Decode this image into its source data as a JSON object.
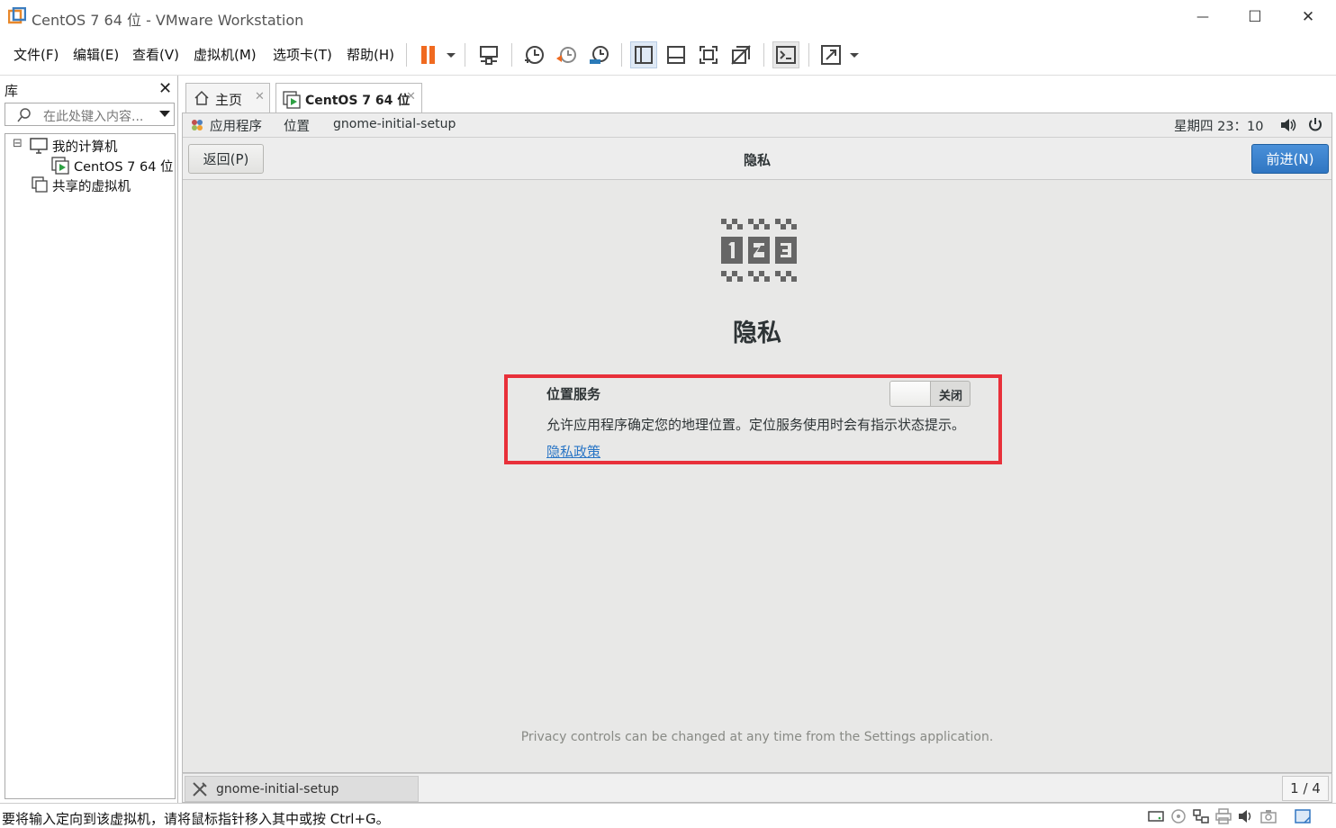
{
  "window": {
    "title": "CentOS 7 64 位 - VMware Workstation",
    "minimize_glyph": "—",
    "maximize_glyph": "☐",
    "close_glyph": "✕"
  },
  "menu": {
    "items": [
      "文件(F)",
      "编辑(E)",
      "查看(V)",
      "虚拟机(M)",
      "选项卡(T)",
      "帮助(H)"
    ]
  },
  "library": {
    "title": "库",
    "close_glyph": "✕",
    "search_placeholder": "在此处键入内容...",
    "tree": {
      "my_computer": "我的计算机",
      "vm": "CentOS 7 64 位",
      "shared": "共享的虚拟机",
      "collapse_glyph": "⊟"
    }
  },
  "tabs": [
    {
      "label": "主页",
      "close": "✕"
    },
    {
      "label": "CentOS 7 64 位",
      "close": "✕"
    }
  ],
  "guest": {
    "topbar": {
      "applications": "应用程序",
      "places": "位置",
      "app_name": "gnome-initial-setup",
      "clock": "星期四 23：10"
    },
    "header": {
      "back": "返回(P)",
      "title": "隐私",
      "next": "前进(N)"
    },
    "heading": "隐私",
    "location": {
      "label": "位置服务",
      "toggle_state": "关闭",
      "description": "允许应用程序确定您的地理位置。定位服务使用时会有指示状态提示。",
      "policy_link": "隐私政策"
    },
    "footer_note": "Privacy controls can be changed at any time from the Settings application.",
    "taskbar": {
      "item": "gnome-initial-setup",
      "page_counter": "1 / 4"
    }
  },
  "statusbar": {
    "text": "要将输入定向到该虚拟机，请将鼠标指针移入其中或按 Ctrl+G。"
  },
  "colors": {
    "accent_blue": "#3076c2",
    "highlight_red": "#e8303a",
    "pause_orange": "#f06a20"
  }
}
